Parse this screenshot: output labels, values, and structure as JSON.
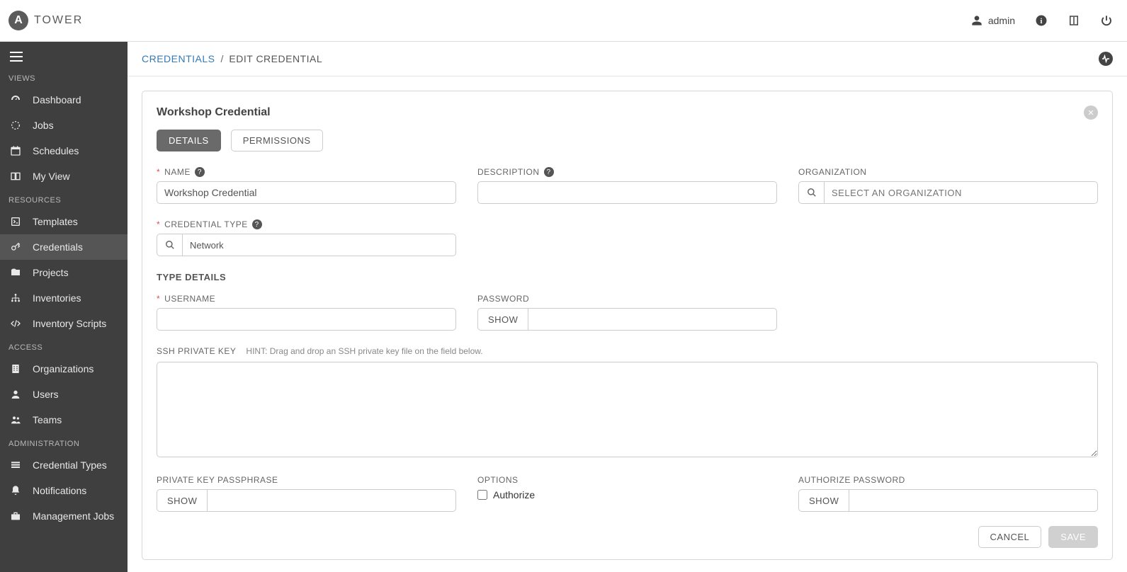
{
  "brand": {
    "letter": "A",
    "name": "TOWER"
  },
  "topbar": {
    "username": "admin"
  },
  "sidebar": {
    "sections": {
      "views": "VIEWS",
      "resources": "RESOURCES",
      "access": "ACCESS",
      "administration": "ADMINISTRATION"
    },
    "items": {
      "dashboard": "Dashboard",
      "jobs": "Jobs",
      "schedules": "Schedules",
      "my_view": "My View",
      "templates": "Templates",
      "credentials": "Credentials",
      "projects": "Projects",
      "inventories": "Inventories",
      "inventory_scripts": "Inventory Scripts",
      "organizations": "Organizations",
      "users": "Users",
      "teams": "Teams",
      "credential_types": "Credential Types",
      "notifications": "Notifications",
      "management_jobs": "Management Jobs"
    }
  },
  "breadcrumb": {
    "root": "CREDENTIALS",
    "sep": "/",
    "current": "EDIT CREDENTIAL"
  },
  "panel": {
    "title": "Workshop Credential",
    "tabs": {
      "details": "DETAILS",
      "permissions": "PERMISSIONS"
    }
  },
  "form": {
    "labels": {
      "name": "NAME",
      "description": "DESCRIPTION",
      "organization": "ORGANIZATION",
      "credential_type": "CREDENTIAL TYPE",
      "type_details": "TYPE DETAILS",
      "username": "USERNAME",
      "password": "PASSWORD",
      "ssh_private_key": "SSH PRIVATE KEY",
      "ssh_hint": "HINT: Drag and drop an SSH private key file on the field below.",
      "private_key_passphrase": "PRIVATE KEY PASSPHRASE",
      "options": "OPTIONS",
      "authorize": "Authorize",
      "authorize_password": "AUTHORIZE PASSWORD"
    },
    "values": {
      "name": "Workshop Credential",
      "description": "",
      "organization_placeholder": "SELECT AN ORGANIZATION",
      "credential_type": "Network",
      "username": "",
      "password": "",
      "ssh_private_key": "",
      "private_key_passphrase": "",
      "authorize_checked": false,
      "authorize_password": ""
    },
    "buttons": {
      "show": "SHOW",
      "cancel": "CANCEL",
      "save": "SAVE"
    }
  }
}
